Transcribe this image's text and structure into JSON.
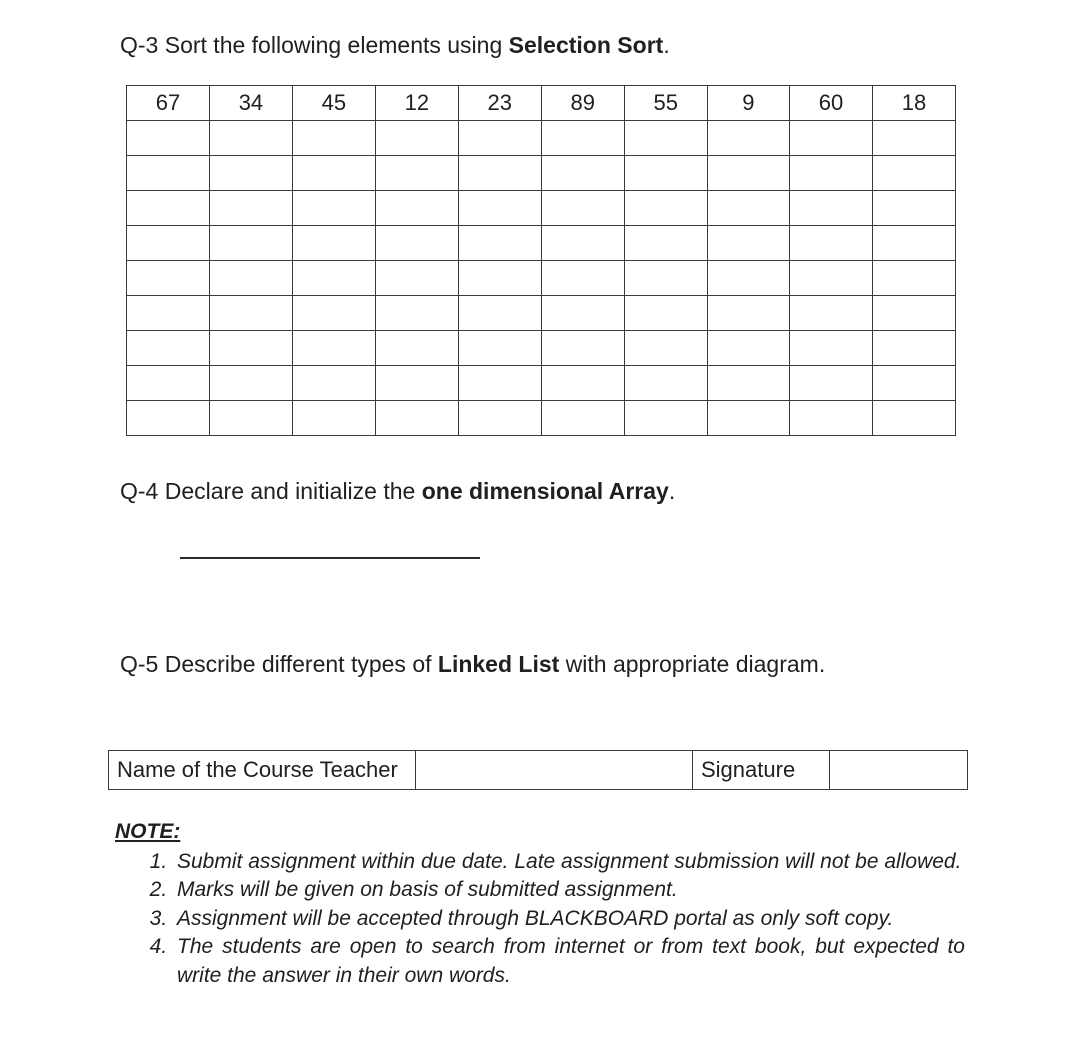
{
  "q3": {
    "prefix": "Q-3 Sort the following elements using ",
    "bold": "Selection Sort",
    "suffix": ".",
    "values": [
      "67",
      "34",
      "45",
      "12",
      "23",
      "89",
      "55",
      "9",
      "60",
      "18"
    ],
    "blank_rows": 9
  },
  "q4": {
    "prefix": "Q-4 Declare and initialize the ",
    "bold": "one dimensional Array",
    "suffix": "."
  },
  "q5": {
    "prefix": "Q-5 Describe different types of ",
    "bold": "Linked List",
    "suffix": " with appropriate diagram."
  },
  "sign": {
    "teacher_label": "Name of the Course Teacher",
    "signature_label": "Signature"
  },
  "note": {
    "title": "NOTE:",
    "items": [
      "Submit assignment within due date. Late assignment submission will not be allowed.",
      "Marks will be given on basis of submitted assignment.",
      "Assignment will be accepted through BLACKBOARD portal as only soft copy.",
      "The students are open to search from internet or from text book, but expected to write the answer in their own words."
    ]
  }
}
